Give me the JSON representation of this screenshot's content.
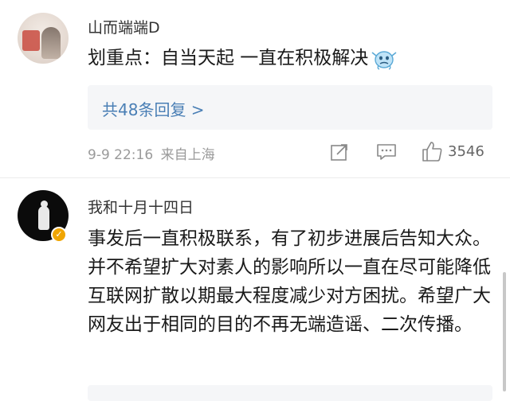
{
  "comments": [
    {
      "username": "山而端端D",
      "content": "划重点：自当天起 一直在积极解决",
      "emoji": "crying-emoji",
      "replies_label": "共48条回复 >",
      "timestamp": "9-9 22:16",
      "location": "来自上海",
      "likes": "3546"
    },
    {
      "username": "我和十月十四日",
      "verified": true,
      "content": "事发后一直积极联系，有了初步进展后告知大众。并不希望扩大对素人的影响所以一直在尽可能降低互联网扩散以期最大程度减少对方困扰。希望广大网友出于相同的目的不再无端造谣、二次传播。"
    }
  ],
  "colors": {
    "link": "#4a7fb5",
    "meta": "#9a9a9a",
    "verified": "#f0a500",
    "reply_bg": "#f5f6f8"
  },
  "icons": [
    "share-icon",
    "comment-icon",
    "like-icon",
    "verified-icon"
  ]
}
